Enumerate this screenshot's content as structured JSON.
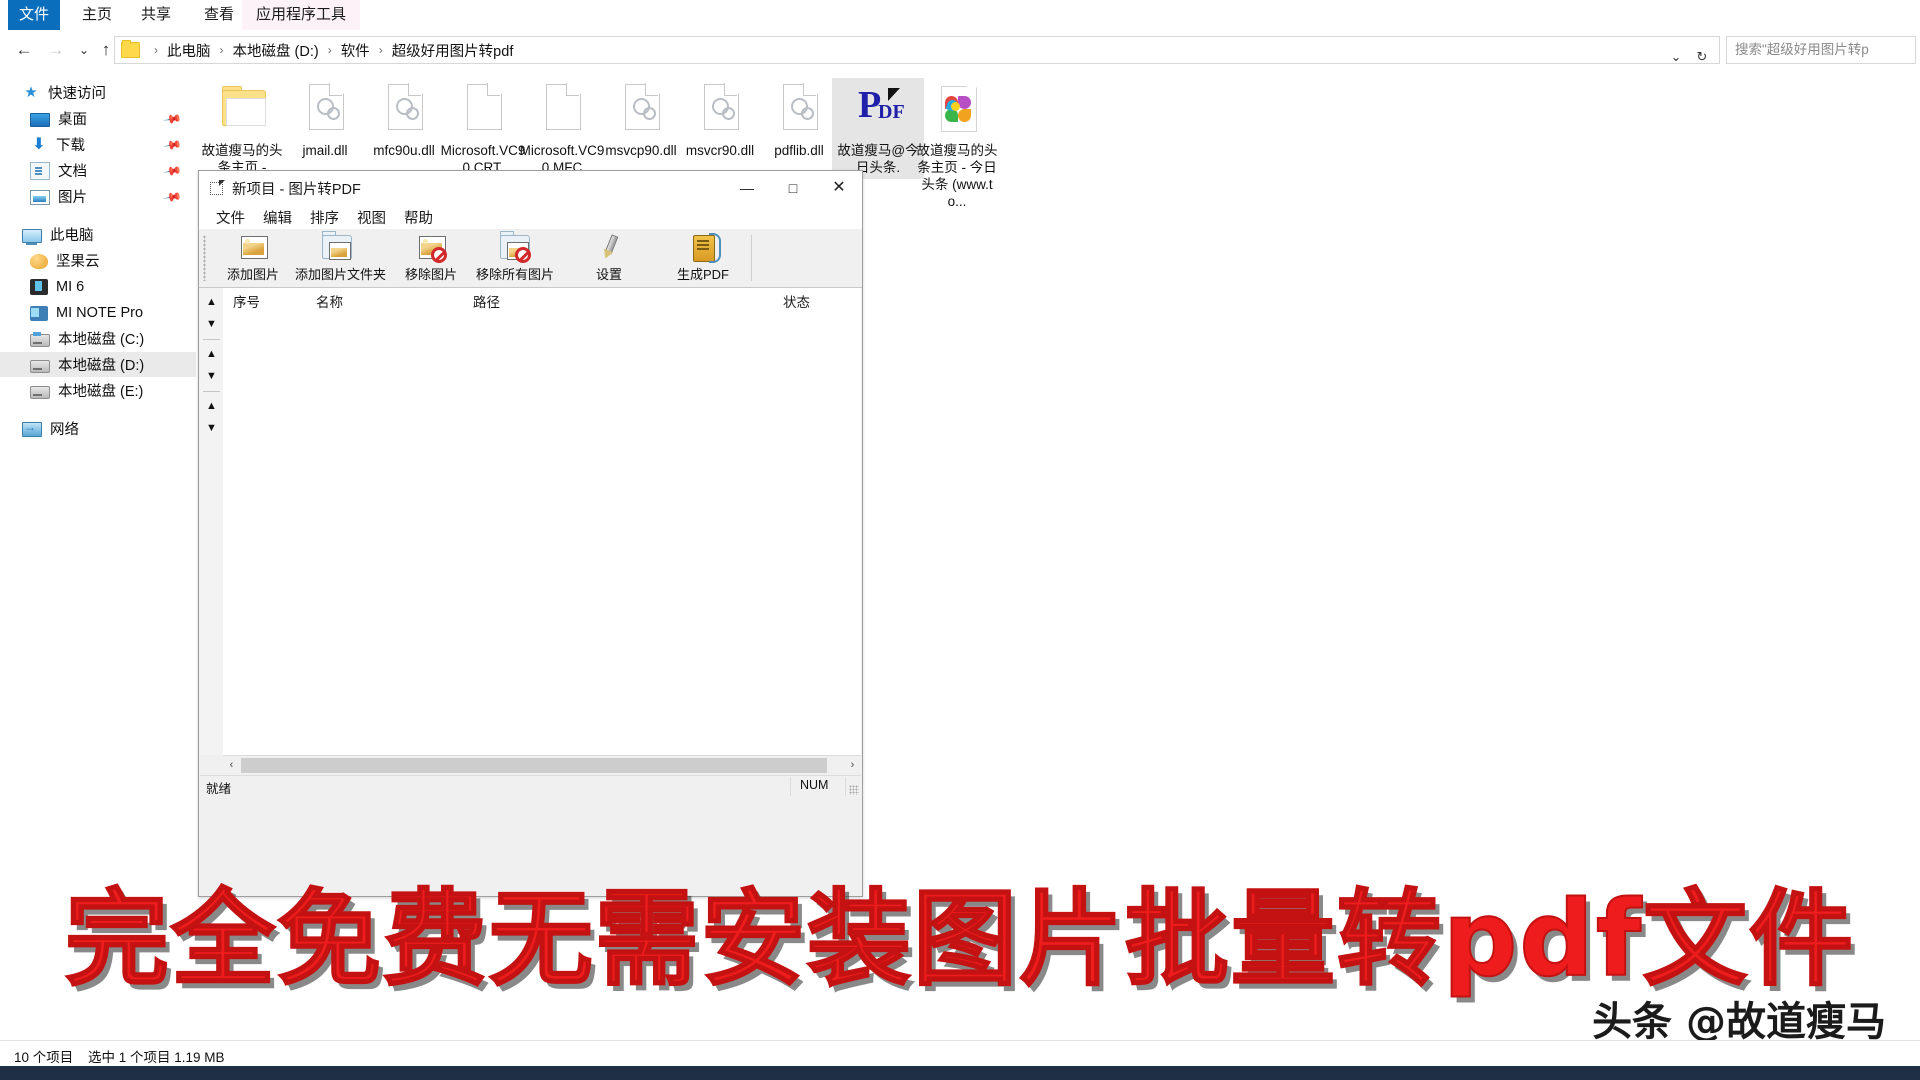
{
  "ribbon": {
    "tabs": [
      {
        "label": "文件",
        "active": true
      },
      {
        "label": "主页",
        "active": false
      },
      {
        "label": "共享",
        "active": false
      },
      {
        "label": "查看",
        "active": false
      },
      {
        "label": "应用程序工具",
        "active": false
      }
    ]
  },
  "address": {
    "back_icon": "←",
    "forward_icon": "→",
    "history_icon": "⌄",
    "up_icon": "↑",
    "breadcrumbs": [
      "此电脑",
      "本地磁盘 (D:)",
      "软件",
      "超级好用图片转pdf"
    ],
    "separator": "›",
    "dropdown_icon": "⌄",
    "refresh_icon": "↻",
    "search_placeholder": "搜索\"超级好用图片转p"
  },
  "navpane": {
    "items": [
      {
        "label": "快速访问",
        "icon": "star-icon",
        "indent": 0,
        "pinned": false,
        "selected": false
      },
      {
        "label": "桌面",
        "icon": "desktop-icon",
        "indent": 1,
        "pinned": true,
        "selected": false
      },
      {
        "label": "下载",
        "icon": "download-icon",
        "indent": 1,
        "pinned": true,
        "selected": false
      },
      {
        "label": "文档",
        "icon": "document-icon",
        "indent": 1,
        "pinned": true,
        "selected": false
      },
      {
        "label": "图片",
        "icon": "pictures-icon",
        "indent": 1,
        "pinned": true,
        "selected": false
      },
      {
        "label": "此电脑",
        "icon": "this-pc-icon",
        "indent": 0,
        "pinned": false,
        "selected": false
      },
      {
        "label": "坚果云",
        "icon": "nutstore-icon",
        "indent": 1,
        "pinned": false,
        "selected": false
      },
      {
        "label": "MI 6",
        "icon": "phone-icon",
        "indent": 1,
        "pinned": false,
        "selected": false
      },
      {
        "label": "MI NOTE Pro",
        "icon": "phone-icon",
        "indent": 1,
        "pinned": false,
        "selected": false
      },
      {
        "label": "本地磁盘 (C:)",
        "icon": "system-drive-icon",
        "indent": 1,
        "pinned": false,
        "selected": false
      },
      {
        "label": "本地磁盘 (D:)",
        "icon": "drive-icon",
        "indent": 1,
        "pinned": false,
        "selected": true
      },
      {
        "label": "本地磁盘 (E:)",
        "icon": "drive-icon",
        "indent": 1,
        "pinned": false,
        "selected": false
      },
      {
        "label": "网络",
        "icon": "network-icon",
        "indent": 0,
        "pinned": false,
        "selected": false
      }
    ]
  },
  "files": [
    {
      "name": "故道瘦马的头条主页 -",
      "icon": "folder-icon",
      "selected": false
    },
    {
      "name": "jmail.dll",
      "icon": "dll-icon",
      "selected": false
    },
    {
      "name": "mfc90u.dll",
      "icon": "dll-icon",
      "selected": false
    },
    {
      "name": "Microsoft.VC90.CRT.",
      "icon": "blank-file-icon",
      "selected": false
    },
    {
      "name": "Microsoft.VC90.MFC",
      "icon": "blank-file-icon",
      "selected": false
    },
    {
      "name": "msvcp90.dll",
      "icon": "dll-icon",
      "selected": false
    },
    {
      "name": "msvcr90.dll",
      "icon": "dll-icon",
      "selected": false
    },
    {
      "name": "pdflib.dll",
      "icon": "dll-icon",
      "selected": false
    },
    {
      "name": "故道瘦马@今日头条.",
      "icon": "pdf-icon",
      "selected": true
    },
    {
      "name": "故道瘦马的头条主页 - 今日头条 (www.to...",
      "icon": "pinwheel-image-icon",
      "selected": false
    }
  ],
  "app_window": {
    "title": "新项目 - 图片转PDF",
    "window_buttons": {
      "minimize": "—",
      "maximize": "□",
      "close": "✕"
    },
    "menu": [
      "文件",
      "编辑",
      "排序",
      "视图",
      "帮助"
    ],
    "toolbar": [
      {
        "label": "添加图片",
        "icon": "add-image-icon"
      },
      {
        "label": "添加图片文件夹",
        "icon": "add-image-folder-icon"
      },
      {
        "label": "移除图片",
        "icon": "remove-image-icon"
      },
      {
        "label": "移除所有图片",
        "icon": "remove-all-images-icon"
      },
      {
        "label": "设置",
        "icon": "settings-pen-icon"
      },
      {
        "label": "生成PDF",
        "icon": "generate-pdf-icon"
      }
    ],
    "list_columns": [
      "序号",
      "名称",
      "路径",
      "状态"
    ],
    "list_rows": [],
    "side_buttons": [
      {
        "icon": "move-up-icon",
        "glyph": "▲"
      },
      {
        "icon": "move-down-icon",
        "glyph": "▼"
      },
      {
        "icon": "move-up-step-icon",
        "glyph": "▲"
      },
      {
        "icon": "move-down-step-icon",
        "glyph": "▼"
      },
      {
        "icon": "move-top-icon",
        "glyph": "▲"
      },
      {
        "icon": "move-bottom-icon",
        "glyph": "▼"
      }
    ],
    "hscroll": {
      "left_arrow": "‹",
      "right_arrow": "›"
    },
    "status": {
      "text": "就绪",
      "num_lock": "NUM"
    }
  },
  "overlay": {
    "headline": "完全免费无需安装图片批量转pdf文件",
    "watermark": "头条 @故道瘦马"
  },
  "explorer_status": {
    "item_count": "10 个项目",
    "selection": "选中 1 个项目  1.19 MB"
  },
  "colors": {
    "file_tab_blue": "#0a6ebd",
    "selection_gray": "#e5e5e5",
    "headline_red": "#ee1c1c"
  }
}
